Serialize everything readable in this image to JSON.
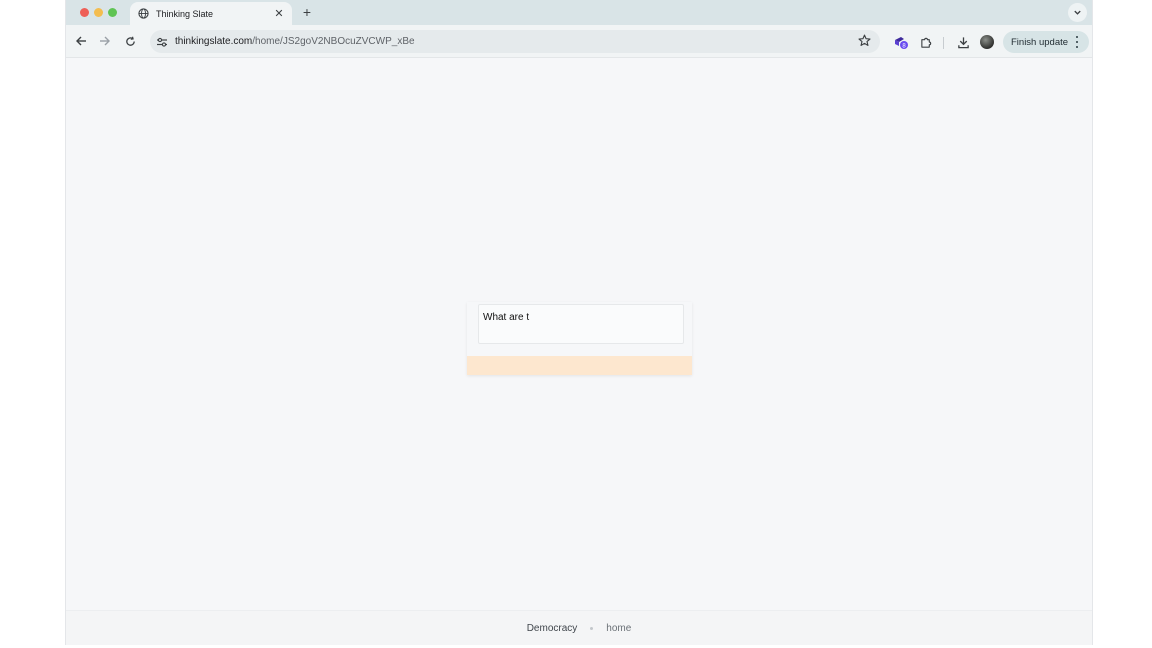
{
  "browser": {
    "tab": {
      "title": "Thinking Slate",
      "icon": "globe-icon"
    },
    "url": {
      "host": "thinkingslate.com",
      "path": "/home/JS2goV2NBOcuZVCWP_xBe"
    },
    "extension_badge": "8",
    "finish_update_label": "Finish update"
  },
  "main": {
    "input_value": "What are t",
    "accent_color": "#fde7cf"
  },
  "footer": {
    "breadcrumb": [
      "Democracy",
      "home"
    ]
  }
}
